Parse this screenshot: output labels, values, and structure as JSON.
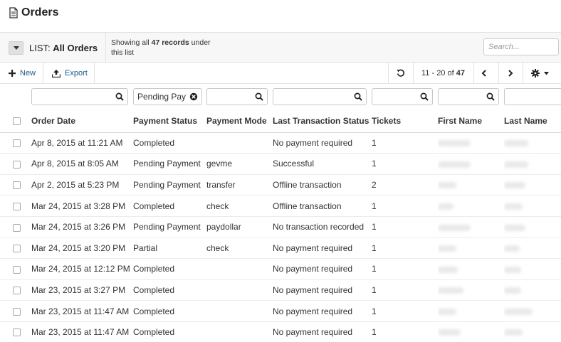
{
  "page": {
    "title": "Orders",
    "icon": "document-icon"
  },
  "listbar": {
    "prefix": "LIST:",
    "name": "All Orders",
    "info_pre": "Showing all",
    "info_count": "47 records",
    "info_post": "under this list",
    "search_placeholder": "Search..."
  },
  "toolbar": {
    "new_label": "New",
    "export_label": "Export",
    "pager_range": "11 - 20 of",
    "pager_total": "47"
  },
  "filters": [
    {
      "value": "",
      "icon": "search-icon"
    },
    {
      "value": "Pending Payr",
      "icon": "clear-icon"
    },
    {
      "value": "",
      "icon": "search-icon"
    },
    {
      "value": "",
      "icon": "search-icon"
    },
    {
      "value": "",
      "icon": "search-icon"
    },
    {
      "value": "",
      "icon": "search-icon"
    },
    {
      "value": "",
      "icon": "search-icon"
    }
  ],
  "columns": [
    "Order Date",
    "Payment Status",
    "Payment Mode",
    "Last Transaction Status",
    "Tickets",
    "First Name",
    "Last Name"
  ],
  "rows": [
    {
      "date": "Apr 8, 2015 at 11:21 AM",
      "status": "Completed",
      "mode": "",
      "txn": "No payment required",
      "tickets": "1"
    },
    {
      "date": "Apr 8, 2015 at 8:05 AM",
      "status": "Pending Payment",
      "mode": "gevme",
      "txn": "Successful",
      "tickets": "1"
    },
    {
      "date": "Apr 2, 2015 at 5:23 PM",
      "status": "Pending Payment",
      "mode": "transfer",
      "txn": "Offline transaction",
      "tickets": "2"
    },
    {
      "date": "Mar 24, 2015 at 3:28 PM",
      "status": "Completed",
      "mode": "check",
      "txn": "Offline transaction",
      "tickets": "1"
    },
    {
      "date": "Mar 24, 2015 at 3:26 PM",
      "status": "Pending Payment",
      "mode": "paydollar",
      "txn": "No transaction recorded",
      "tickets": "1"
    },
    {
      "date": "Mar 24, 2015 at 3:20 PM",
      "status": "Partial",
      "mode": "check",
      "txn": "No payment required",
      "tickets": "1"
    },
    {
      "date": "Mar 24, 2015 at 12:12 PM",
      "status": "Completed",
      "mode": "",
      "txn": "No payment required",
      "tickets": "1"
    },
    {
      "date": "Mar 23, 2015 at 3:27 PM",
      "status": "Completed",
      "mode": "",
      "txn": "No payment required",
      "tickets": "1"
    },
    {
      "date": "Mar 23, 2015 at 11:47 AM",
      "status": "Completed",
      "mode": "",
      "txn": "No payment required",
      "tickets": "1"
    },
    {
      "date": "Mar 23, 2015 at 11:47 AM",
      "status": "Completed",
      "mode": "",
      "txn": "No payment required",
      "tickets": "1"
    }
  ],
  "colors": {
    "link": "#1a5a8a",
    "header_bg": "#f7f7f7",
    "border": "#e2e2e2"
  }
}
